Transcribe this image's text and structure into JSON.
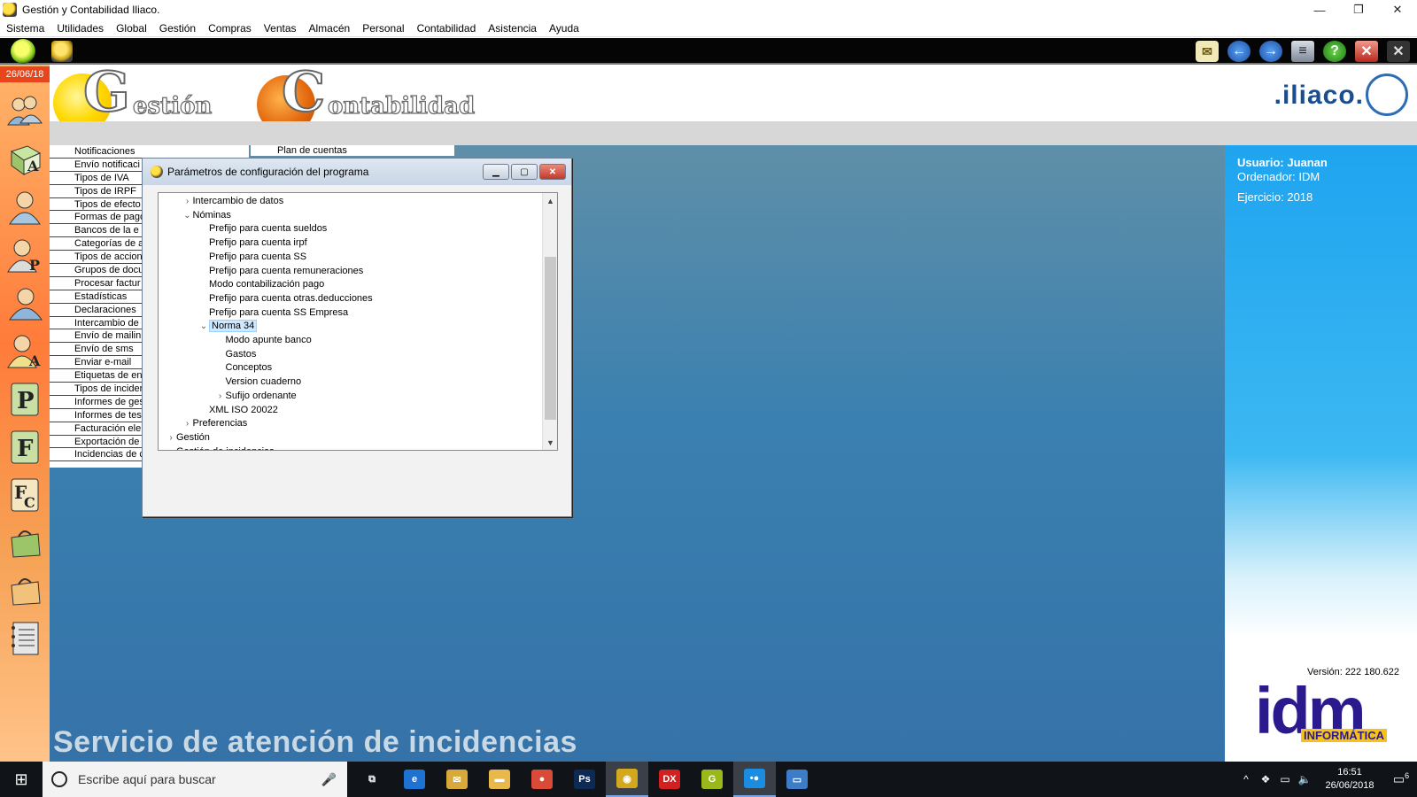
{
  "window": {
    "title": "Gestión y Contabilidad Iliaco.",
    "controls": [
      "—",
      "❐",
      "✕"
    ]
  },
  "menu": [
    "Sistema",
    "Utilidades",
    "Global",
    "Gestión",
    "Compras",
    "Ventas",
    "Almacén",
    "Personal",
    "Contabilidad",
    "Asistencia",
    "Ayuda"
  ],
  "sidebar": {
    "date": "26/06/18",
    "icons": [
      "users-icon",
      "book-icon",
      "person-icon",
      "person-p-icon",
      "group-icon",
      "person-a-icon",
      "p-document-icon",
      "f-document-icon",
      "fc-document-icon",
      "bag-green-icon",
      "bag-orange-icon",
      "notebook-icon"
    ],
    "letters": [
      "",
      "A",
      "",
      "P",
      "",
      "A",
      "P",
      "F",
      "Fc",
      "",
      "",
      ""
    ]
  },
  "header": {
    "gestion_letter": "G",
    "gestion_word": "estión",
    "contab_letter": "C",
    "contab_word": "ontabilidad",
    "brand": ".iliaco."
  },
  "background_list": {
    "column1": [
      "Notificaciones",
      "Envío notificaci",
      "Tipos de IVA",
      "Tipos de IRPF",
      "Tipos de efecto",
      "Formas de pago",
      "Bancos de la e",
      "Categorías de a",
      "Tipos de accion",
      "Grupos de docu",
      "Procesar factur",
      "Estadísticas",
      "Declaraciones",
      "Intercambio de",
      "Envío de mailin",
      "Envío de sms",
      "Enviar e-mail",
      "Etiquetas de en",
      "Tipos de inciden",
      "Informes de ges",
      "Informes de tes",
      "Facturación ele",
      "Exportación de",
      "Incidencias de c"
    ],
    "column2_first": "Plan de cuentas"
  },
  "info_panel": {
    "usuario": "Usuario: Juanan",
    "ordenador": "Ordenador: IDM",
    "ejercicio": "Ejercicio: 2018",
    "version": "Versión: 222 180.622",
    "logo_main": "idm",
    "logo_sub": "INFORMÁTICA"
  },
  "main": {
    "support_text": "Servicio de atención de incidencias"
  },
  "dialog": {
    "title": "Parámetros de configuración del programa",
    "tree": [
      {
        "label": "Intercambio de datos",
        "level": 1,
        "toggle": "›"
      },
      {
        "label": "Nóminas",
        "level": 1,
        "toggle": "⌄"
      },
      {
        "label": "Prefijo para cuenta sueldos",
        "level": 2,
        "toggle": ""
      },
      {
        "label": "Prefijo para cuenta irpf",
        "level": 2,
        "toggle": ""
      },
      {
        "label": "Prefijo para cuenta SS",
        "level": 2,
        "toggle": ""
      },
      {
        "label": "Prefijo para cuenta remuneraciones",
        "level": 2,
        "toggle": ""
      },
      {
        "label": "Modo contabilización pago",
        "level": 2,
        "toggle": ""
      },
      {
        "label": "Prefijo para cuenta otras.deducciones",
        "level": 2,
        "toggle": ""
      },
      {
        "label": "Prefijo para cuenta SS Empresa",
        "level": 2,
        "toggle": ""
      },
      {
        "label": "Norma 34",
        "level": 2,
        "toggle": "⌄",
        "selected": true
      },
      {
        "label": "Modo apunte banco",
        "level": 3,
        "toggle": ""
      },
      {
        "label": "Gastos",
        "level": 3,
        "toggle": ""
      },
      {
        "label": "Conceptos",
        "level": 3,
        "toggle": ""
      },
      {
        "label": "Version cuaderno",
        "level": 3,
        "toggle": ""
      },
      {
        "label": "Sufijo ordenante",
        "level": 3,
        "toggle": "›"
      },
      {
        "label": "XML ISO 20022",
        "level": 2,
        "toggle": ""
      },
      {
        "label": "Preferencias",
        "level": 1,
        "toggle": "›"
      },
      {
        "label": "Gestión",
        "level": 0,
        "toggle": "›"
      },
      {
        "label": "Gestión de incidencias",
        "level": 0,
        "toggle": "›"
      }
    ]
  },
  "taskbar": {
    "search_placeholder": "Escribe aquí para buscar",
    "time": "16:51",
    "date": "26/06/2018",
    "notifications": "6",
    "apps": [
      {
        "name": "task-view",
        "label": "⧉",
        "color": "#101318"
      },
      {
        "name": "edge",
        "label": "e",
        "color": "#1e73d2"
      },
      {
        "name": "mail",
        "label": "✉",
        "color": "#d8a93a"
      },
      {
        "name": "explorer",
        "label": "▬",
        "color": "#e8b84a"
      },
      {
        "name": "chrome",
        "label": "●",
        "color": "#d94a38"
      },
      {
        "name": "photoshop",
        "label": "Ps",
        "color": "#0c2a54"
      },
      {
        "name": "iliaco",
        "label": "◉",
        "color": "#d2a81c"
      },
      {
        "name": "dx",
        "label": "DX",
        "color": "#d21f1f"
      },
      {
        "name": "gestion",
        "label": "G",
        "color": "#9bb81a"
      },
      {
        "name": "messenger",
        "label": "•●",
        "color": "#1a8de0"
      },
      {
        "name": "remote",
        "label": "▭",
        "color": "#3d7dc8"
      }
    ]
  }
}
